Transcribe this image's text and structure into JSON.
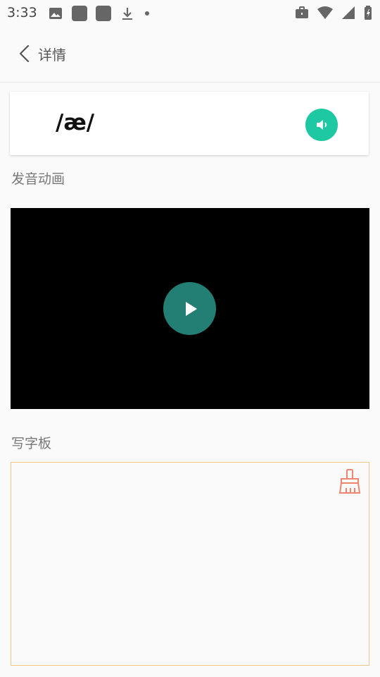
{
  "status_bar": {
    "time": "3:33"
  },
  "app_bar": {
    "title": "详情"
  },
  "phonetic": {
    "symbol": "/æ/"
  },
  "sections": {
    "animation_label": "发音动画",
    "writing_label": "写字板"
  },
  "colors": {
    "accent": "#1dc8a3",
    "play_button": "#237f73",
    "board_border": "#f1c487",
    "broom": "#f0856f"
  },
  "icons": {
    "back": "chevron-left",
    "speaker": "volume",
    "play": "play",
    "clear": "broom"
  }
}
